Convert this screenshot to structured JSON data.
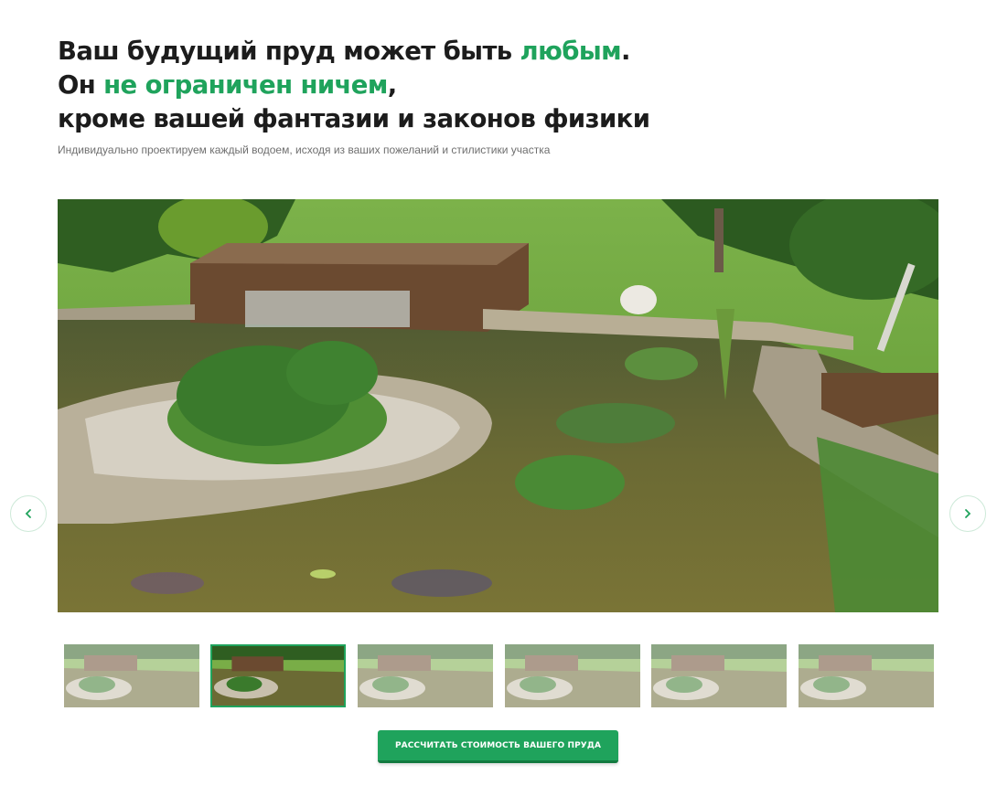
{
  "headline": {
    "line1_start": "Ваш будущий пруд может быть ",
    "line1_accent": "любым",
    "line1_end": ".",
    "line2_start": "Он ",
    "line2_accent": "не ограничен ничем",
    "line2_end": ",",
    "line3": "кроме вашей фантазии и законов физики"
  },
  "subtitle": "Индивидуально проектируем каждый водоем, исходя из ваших пожеланий и стилистики участка",
  "slider": {
    "prev_icon": "chevron-left-icon",
    "next_icon": "chevron-right-icon",
    "active_index": 1,
    "thumbnail_count": 6
  },
  "cta": {
    "label": "РАССЧИТАТЬ СТОИМОСТЬ ВАШЕГО ПРУДА"
  },
  "colors": {
    "accent": "#1fa35c",
    "accent_dark": "#137a3f",
    "text": "#1c1c1c",
    "muted": "#6f6f6f"
  }
}
